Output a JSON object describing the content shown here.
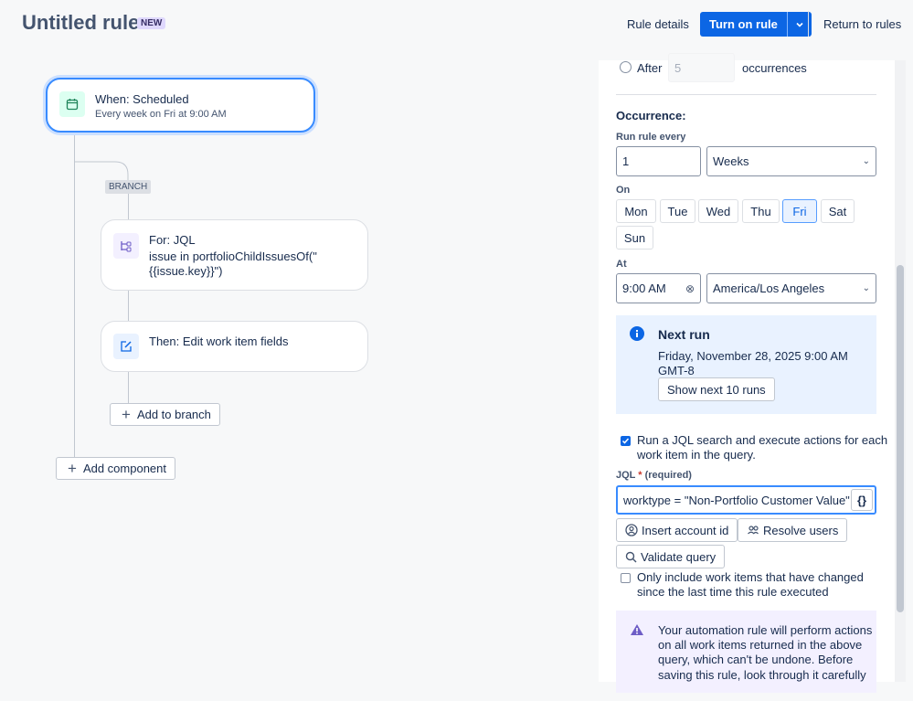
{
  "header": {
    "title": "Untitled rule",
    "badge": "NEW",
    "rule_details": "Rule details",
    "turn_on": "Turn on rule",
    "return": "Return to rules"
  },
  "canvas": {
    "trigger": {
      "title": "When: Scheduled",
      "subtitle": "Every week on Fri at 9:00 AM"
    },
    "branch_tag": "BRANCH",
    "for_node": {
      "title": "For: JQL",
      "line1": "issue in portfolioChildIssuesOf(\"",
      "line2": "{{issue.key}}\")"
    },
    "then_node": {
      "title": "Then: Edit work item fields"
    },
    "add_to_branch": "Add to branch",
    "add_component": "Add component"
  },
  "panel": {
    "after_label": "After",
    "after_value": "5",
    "occurrences": "occurrences",
    "occurrence_heading": "Occurrence:",
    "run_every_label": "Run rule every",
    "run_every_value": "1",
    "unit": "Weeks",
    "on_label": "On",
    "days": [
      "Mon",
      "Tue",
      "Wed",
      "Thu",
      "Fri",
      "Sat",
      "Sun"
    ],
    "selected_day": "Fri",
    "at_label": "At",
    "time_value": "9:00 AM",
    "timezone": "America/Los Angeles",
    "next_run": {
      "title": "Next run",
      "line1": "Friday, November 28, 2025 9:00 AM",
      "line2": "GMT-8",
      "button": "Show next 10 runs"
    },
    "jql_check": {
      "line1": "Run a JQL search and execute actions for each",
      "line2": "work item in the query."
    },
    "jql_label": "JQL",
    "required_mark": "*",
    "required_text": "(required)",
    "jql_value": "worktype = \"Non-Portfolio Customer Value\"",
    "jql_braces": "{}",
    "insert_account": "Insert account id",
    "resolve_users": "Resolve users",
    "validate": "Validate query",
    "only_include": {
      "line1": "Only include work items that have changed",
      "line2": "since the last time this rule executed"
    },
    "warning": {
      "line1": "Your automation rule will perform actions",
      "line2": "on all work items returned in the above",
      "line3": "query, which can't be undone. Before",
      "line4": "saving this rule, look through it carefully"
    }
  },
  "colors": {
    "primary": "#0c66e4",
    "selection": "#388bff",
    "info_bg": "#e9f2ff",
    "warn_bg": "#f3f0ff"
  }
}
